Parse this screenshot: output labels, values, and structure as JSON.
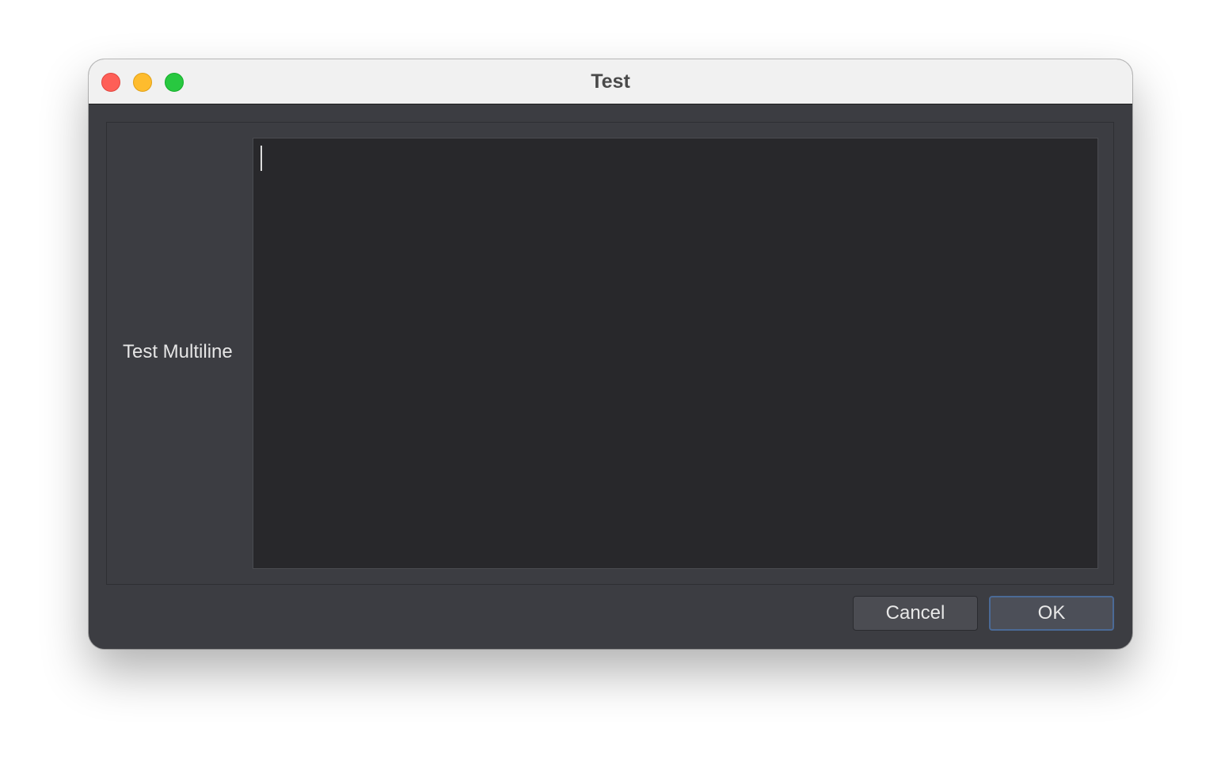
{
  "window": {
    "title": "Test",
    "controls": {
      "close": "close-icon",
      "minimize": "minimize-icon",
      "maximize": "maximize-icon"
    }
  },
  "form": {
    "field_label": "Test Multiline",
    "field_value": ""
  },
  "buttons": {
    "cancel_label": "Cancel",
    "ok_label": "OK"
  },
  "colors": {
    "window_background": "#3c3d42",
    "textarea_background": "#28282b",
    "titlebar_background": "#f1f1f1",
    "close": "#fe5f57",
    "minimize": "#febc2e",
    "maximize": "#28c840",
    "focus_accent": "#4b6a96"
  }
}
